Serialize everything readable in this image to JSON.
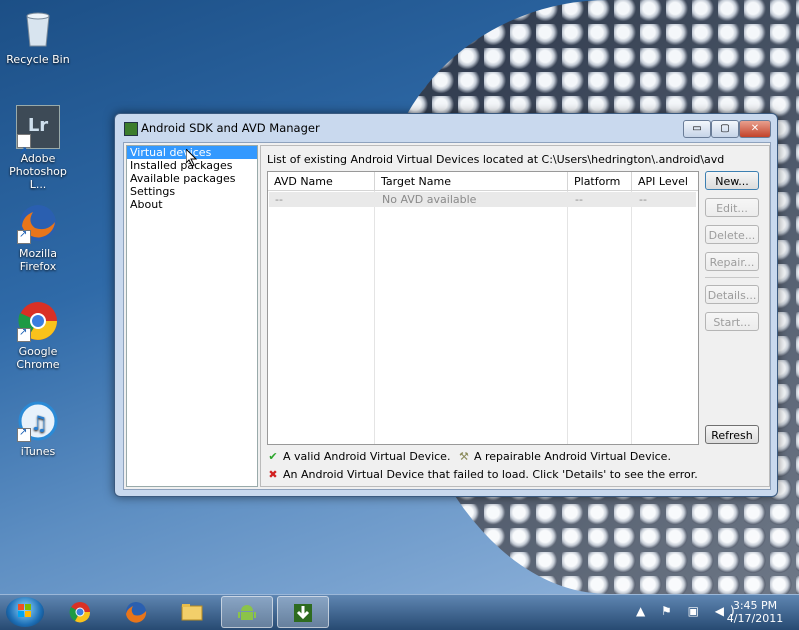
{
  "desktop": {
    "icons": [
      {
        "label": "Recycle Bin"
      },
      {
        "label": "Adobe Photoshop L...",
        "glyph": "Lr"
      },
      {
        "label": "Mozilla Firefox"
      },
      {
        "label": "Google Chrome"
      },
      {
        "label": "iTunes"
      }
    ]
  },
  "window": {
    "title": "Android SDK and AVD Manager",
    "controls": {
      "minimize": "▭",
      "maximize": "▢",
      "close": "✕"
    },
    "nav": [
      {
        "label": "Virtual devices",
        "selected": true
      },
      {
        "label": "Installed packages"
      },
      {
        "label": "Available packages"
      },
      {
        "label": "Settings"
      },
      {
        "label": "About"
      }
    ],
    "heading": "List of existing Android Virtual Devices located at C:\\Users\\hedrington\\.android\\avd",
    "table": {
      "columns": [
        "AVD Name",
        "Target Name",
        "Platform",
        "API Level"
      ],
      "rows": [
        [
          "--",
          "No AVD available",
          "--",
          "--"
        ]
      ]
    },
    "buttons": {
      "new": "New...",
      "edit": "Edit...",
      "delete": "Delete...",
      "repair": "Repair...",
      "details": "Details...",
      "start": "Start...",
      "refresh": "Refresh"
    },
    "legend": {
      "valid": "A valid Android Virtual Device.",
      "repairable": "A repairable Android Virtual Device.",
      "failed": "An Android Virtual Device that failed to load. Click 'Details' to see the error."
    }
  },
  "taskbar": {
    "items": [
      "chrome-icon",
      "firefox-icon",
      "explorer-icon",
      "android-icon",
      "sdk-manager-icon"
    ],
    "tray": "▲ ⚑ ▣ ◀)",
    "time": "3:45 PM",
    "date": "4/17/2011"
  },
  "colors": {
    "selection": "#3399ff",
    "valid_mark": "#2aa52a",
    "failed_mark": "#d12020"
  }
}
